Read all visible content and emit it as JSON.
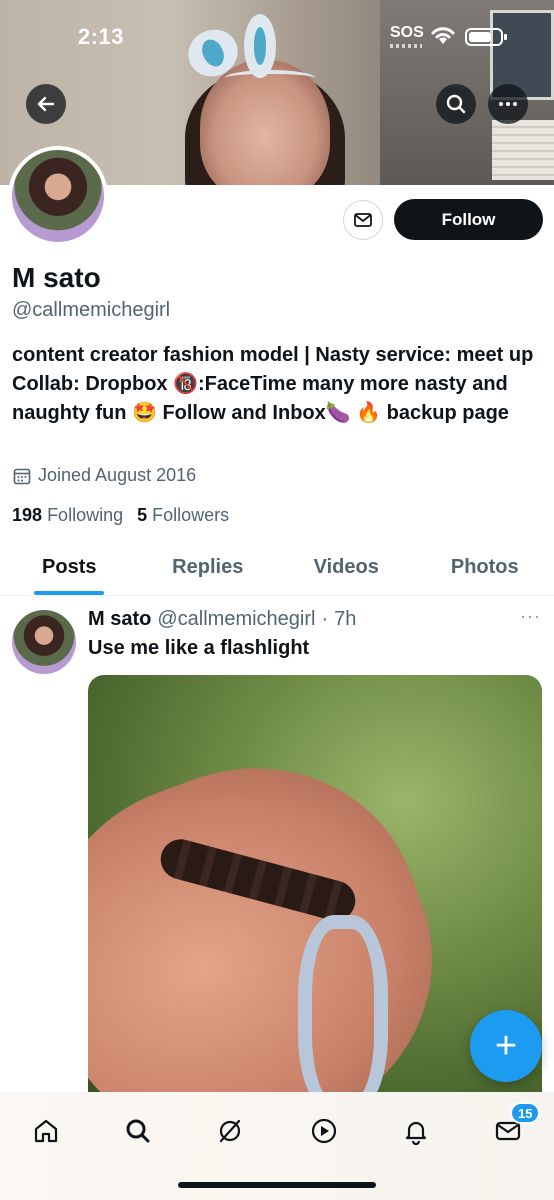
{
  "status_bar": {
    "time": "2:13",
    "carrier": "SOS"
  },
  "profile": {
    "name": "M sato",
    "handle": "@callmemichegirl",
    "bio": "content creator fashion model | Nasty service: meet up Collab: Dropbox 🔞:FaceTime many more nasty and naughty fun 🤩 Follow and Inbox🍆 🔥 backup page",
    "joined": "Joined August 2016",
    "following_count": "198",
    "following_label": "Following",
    "followers_count": "5",
    "followers_label": "Followers",
    "follow_label": "Follow"
  },
  "tabs": [
    {
      "label": "Posts",
      "active": true
    },
    {
      "label": "Replies",
      "active": false
    },
    {
      "label": "Videos",
      "active": false
    },
    {
      "label": "Photos",
      "active": false
    }
  ],
  "post": {
    "name": "M sato",
    "handle": "@callmemichegirl",
    "separator": "·",
    "time": "7h",
    "text": "Use me like a flashlight",
    "more": "···"
  },
  "fab": {
    "label": "+"
  },
  "bottom_nav": {
    "items": [
      "home-icon",
      "search-icon",
      "grok-icon",
      "video-icon",
      "notifications-icon",
      "messages-icon"
    ],
    "messages_badge": "15"
  },
  "colors": {
    "accent": "#1d9bf0",
    "text": "#0f1419",
    "muted": "#536471"
  }
}
